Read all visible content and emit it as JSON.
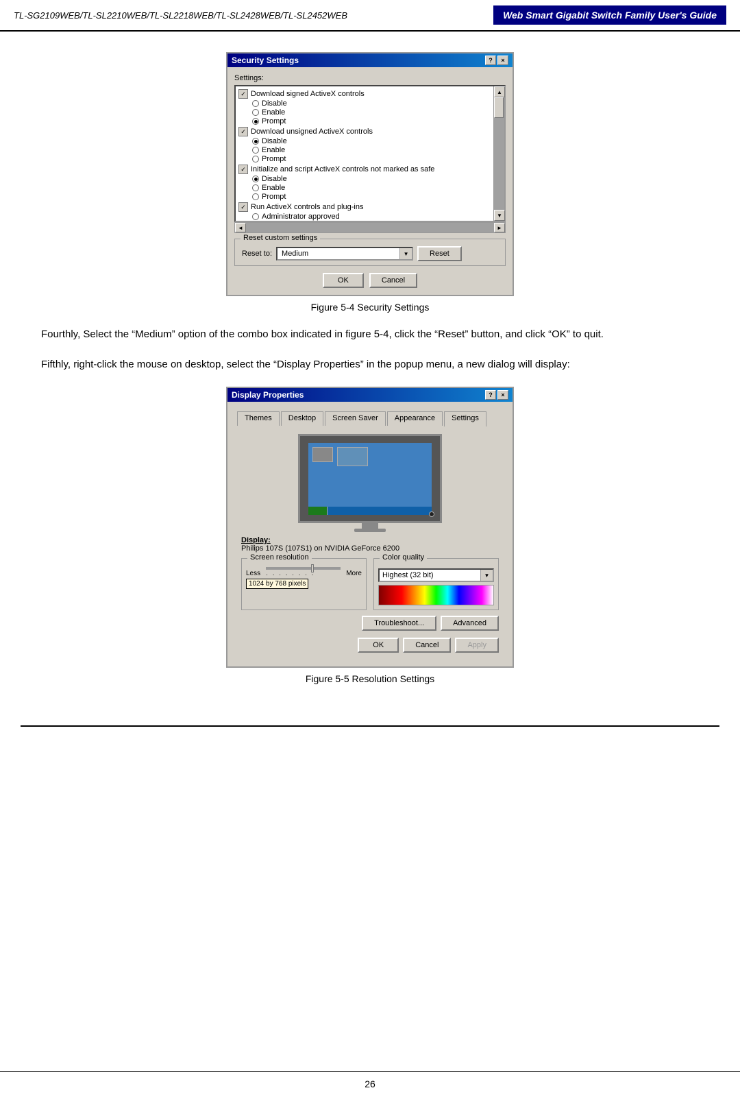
{
  "header": {
    "left": "TL-SG2109WEB/TL-SL2210WEB/TL-SL2218WEB/TL-SL2428WEB/TL-SL2452WEB",
    "right": "Web Smart Gigabit Switch Family User's Guide"
  },
  "security_dialog": {
    "title": "Security Settings",
    "help_btn": "?",
    "close_btn": "×",
    "settings_label": "Settings:",
    "items": [
      {
        "header": "Download signed ActiveX controls",
        "options": [
          "Disable",
          "Enable",
          "Prompt"
        ],
        "selected": 2
      },
      {
        "header": "Download unsigned ActiveX controls",
        "options": [
          "Disable",
          "Enable",
          "Prompt"
        ],
        "selected": 0
      },
      {
        "header": "Initialize and script ActiveX controls not marked as safe",
        "options": [
          "Disable",
          "Enable",
          "Prompt"
        ],
        "selected": 0
      },
      {
        "header": "Run ActiveX controls and plug-ins",
        "options": [
          "Administrator approved"
        ],
        "selected": -1
      }
    ],
    "reset_section_label": "Reset custom settings",
    "reset_to_label": "Reset to:",
    "reset_value": "Medium",
    "reset_btn": "Reset",
    "ok_btn": "OK",
    "cancel_btn": "Cancel"
  },
  "figure4_label": "Figure 5-4  Security Settings",
  "paragraph1": "Fourthly, Select the “Medium” option of the combo box indicated in figure 5-4, click the “Reset” button, and click “OK” to quit.",
  "paragraph2": "Fifthly, right-click the mouse on desktop, select the “Display Properties” in the popup menu, a new dialog will display:",
  "display_dialog": {
    "title": "Display Properties",
    "help_btn": "?",
    "close_btn": "×",
    "tabs": [
      "Themes",
      "Desktop",
      "Screen Saver",
      "Appearance",
      "Settings"
    ],
    "active_tab": "Settings",
    "display_label": "Display:",
    "display_value": "Philips 107S (107S1) on NVIDIA GeForce 6200",
    "screen_resolution_label": "Screen resolution",
    "less_label": "Less",
    "more_label": "More",
    "ticks": "· · · · · · · ·",
    "resolution_value": "1024 by 768 pixels",
    "color_quality_label": "Color quality",
    "color_value": "Highest (32 bit)",
    "troubleshoot_btn": "Troubleshoot...",
    "advanced_btn": "Advanced",
    "ok_btn": "OK",
    "cancel_btn": "Cancel",
    "apply_btn": "Apply"
  },
  "figure5_label": "Figure 5-5  Resolution Settings",
  "page_number": "26"
}
